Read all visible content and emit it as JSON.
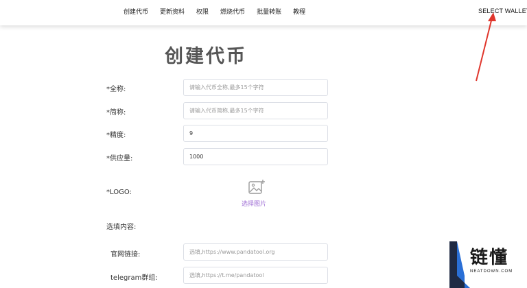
{
  "nav": {
    "items": [
      {
        "label": "创建代币"
      },
      {
        "label": "更新资料"
      },
      {
        "label": "权限"
      },
      {
        "label": "燃烧代币"
      },
      {
        "label": "批量转账"
      },
      {
        "label": "教程"
      }
    ],
    "wallet_button": "SELECT WALLET"
  },
  "page": {
    "title": "创建代币"
  },
  "form": {
    "full_name": {
      "label": "*全称:",
      "placeholder": "请输入代币全称,最多15个字符"
    },
    "short_name": {
      "label": "*简称:",
      "placeholder": "请输入代币简称,最多15个字符"
    },
    "decimals": {
      "label": "*精度:",
      "value": "9"
    },
    "supply": {
      "label": "*供应量:",
      "value": "1000"
    },
    "logo": {
      "label": "*LOGO:",
      "upload_label": "选择图片",
      "icon": "image-add-icon"
    },
    "optional_section": {
      "label": "选填内容:"
    },
    "website": {
      "label": "官网链接:",
      "placeholder": "选填,https://www.pandatool.org"
    },
    "telegram": {
      "label": "telegram群组:",
      "placeholder": "选填,https://t.me/pandatool"
    }
  },
  "watermark": {
    "text": "链懂",
    "sub": "NEATDOWN.COM",
    "accent": "#2a6fd6"
  },
  "colors": {
    "arrow": "#e0362c",
    "upload_accent": "#a070d6"
  }
}
